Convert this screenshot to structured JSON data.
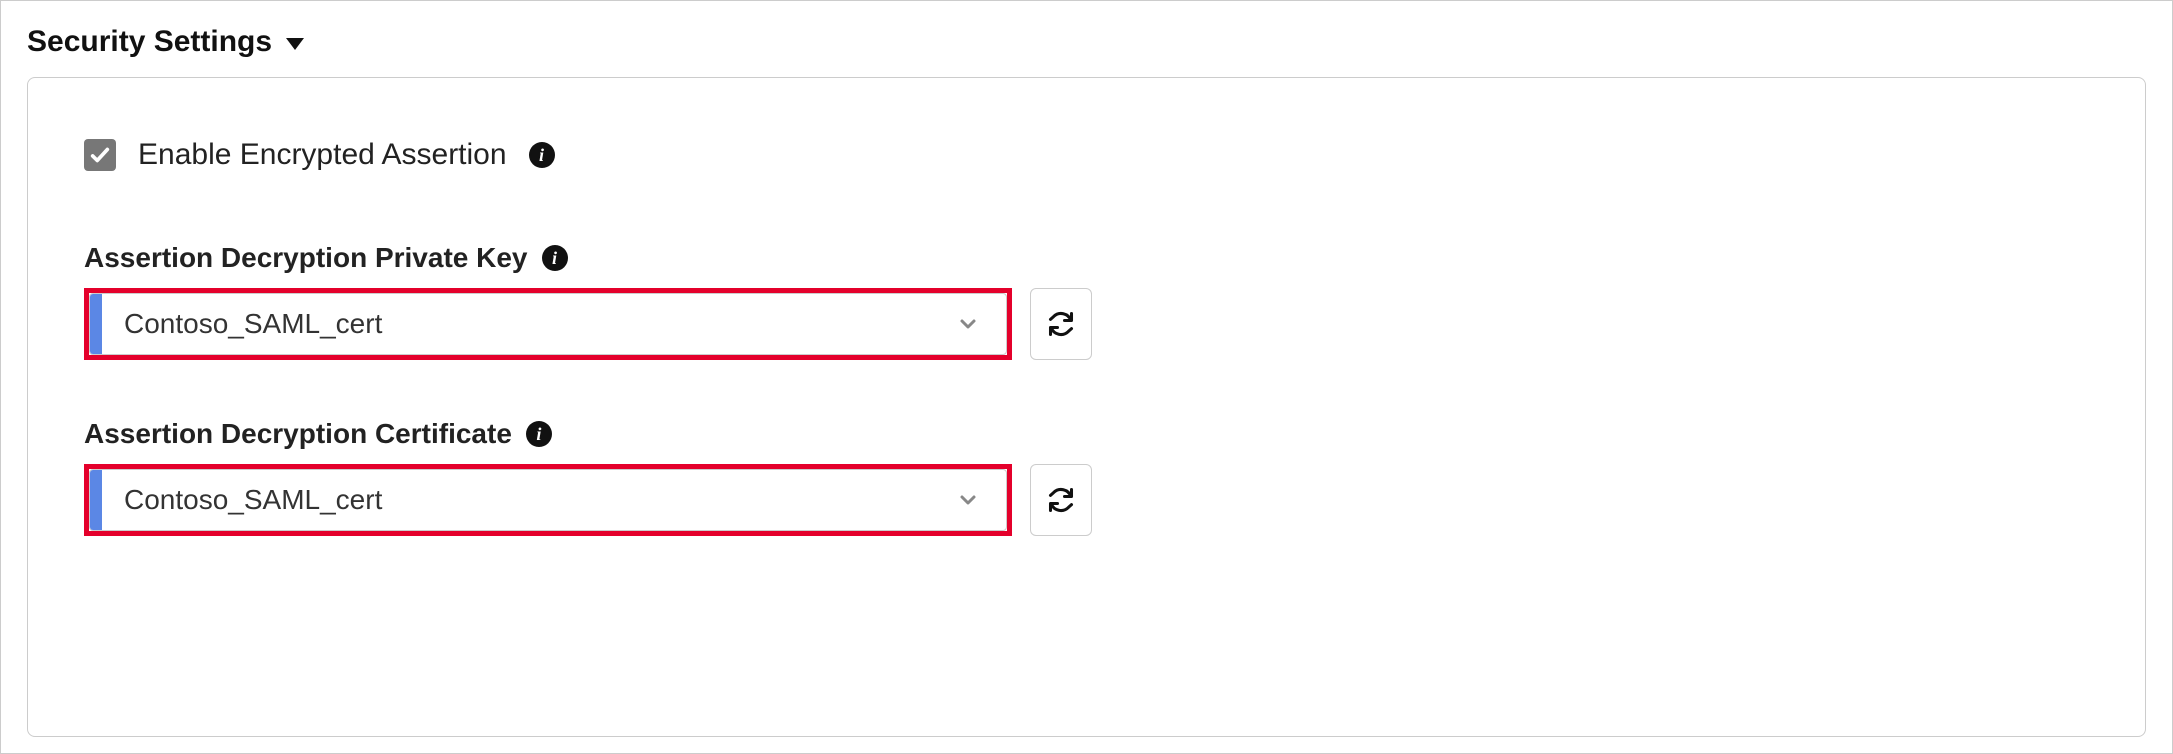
{
  "section": {
    "title": "Security Settings"
  },
  "enable": {
    "label": "Enable Encrypted Assertion",
    "checked": true
  },
  "fields": {
    "privateKey": {
      "label": "Assertion Decryption Private Key",
      "value": "Contoso_SAML_cert"
    },
    "certificate": {
      "label": "Assertion Decryption Certificate",
      "value": "Contoso_SAML_cert"
    }
  }
}
